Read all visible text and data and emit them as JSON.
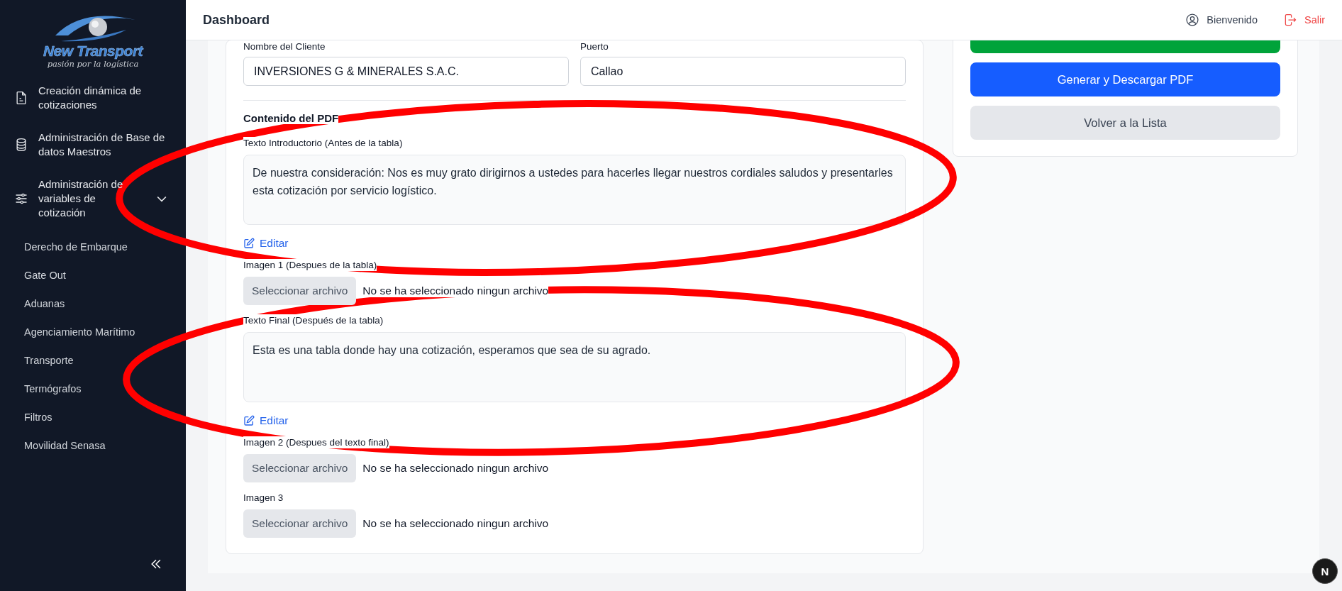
{
  "sidebar": {
    "logo": {
      "name": "New Transport",
      "tagline": "pasión por la logística"
    },
    "items": [
      {
        "label": "Creación dinámica de cotizaciones",
        "kind": "document"
      },
      {
        "label": "Administración de Base de datos Maestros",
        "kind": "database"
      },
      {
        "label": "Administración de variables de cotización",
        "kind": "sliders",
        "expanded": true,
        "children": [
          {
            "label": "Derecho de Embarque"
          },
          {
            "label": "Gate Out"
          },
          {
            "label": "Aduanas"
          },
          {
            "label": "Agenciamiento Marítimo"
          },
          {
            "label": "Transporte"
          },
          {
            "label": "Termógrafos"
          },
          {
            "label": "Filtros"
          },
          {
            "label": "Movilidad Senasa"
          }
        ]
      }
    ]
  },
  "header": {
    "title": "Dashboard",
    "user": "Bienvenido",
    "logout": "Salir"
  },
  "form": {
    "fields": [
      {
        "label": "Nombre del Cliente",
        "value": "INVERSIONES G & MINERALES S.A.C."
      },
      {
        "label": "Puerto",
        "value": "Callao"
      }
    ],
    "section_title": "Contenido del PDF",
    "blocks": [
      {
        "kind": "text",
        "label": "Texto Introductorio (Antes de la tabla)",
        "value": "De nuestra consideración: Nos es muy grato dirigirnos a ustedes para hacerles llegar nuestros cordiales saludos y presentarles esta cotización por servicio logístico.",
        "action": "Editar"
      },
      {
        "kind": "file",
        "label": "Imagen 1 (Despues de la tabla)",
        "button": "Seleccionar archivo",
        "status": "No se ha seleccionado ningun archivo"
      },
      {
        "kind": "text",
        "label": "Texto Final (Después de la tabla)",
        "value": "Esta es una tabla donde hay una cotización, esperamos que sea de su agrado.",
        "action": "Editar"
      },
      {
        "kind": "file",
        "label": "Imagen 2 (Despues del texto final)",
        "button": "Seleccionar archivo",
        "status": "No se ha seleccionado ningun archivo"
      },
      {
        "kind": "file",
        "label": "Imagen 3",
        "button": "Seleccionar archivo",
        "status": "No se ha seleccionado ningun archivo"
      }
    ]
  },
  "actions": [
    {
      "kind": "success"
    },
    {
      "kind": "primary",
      "label": "Generar y Descargar PDF"
    },
    {
      "kind": "secondary",
      "label": "Volver a la Lista"
    }
  ],
  "dev_badge": {
    "label": "N"
  },
  "annotations": [
    {
      "kind": "ellipse"
    },
    {
      "kind": "ellipse"
    }
  ]
}
